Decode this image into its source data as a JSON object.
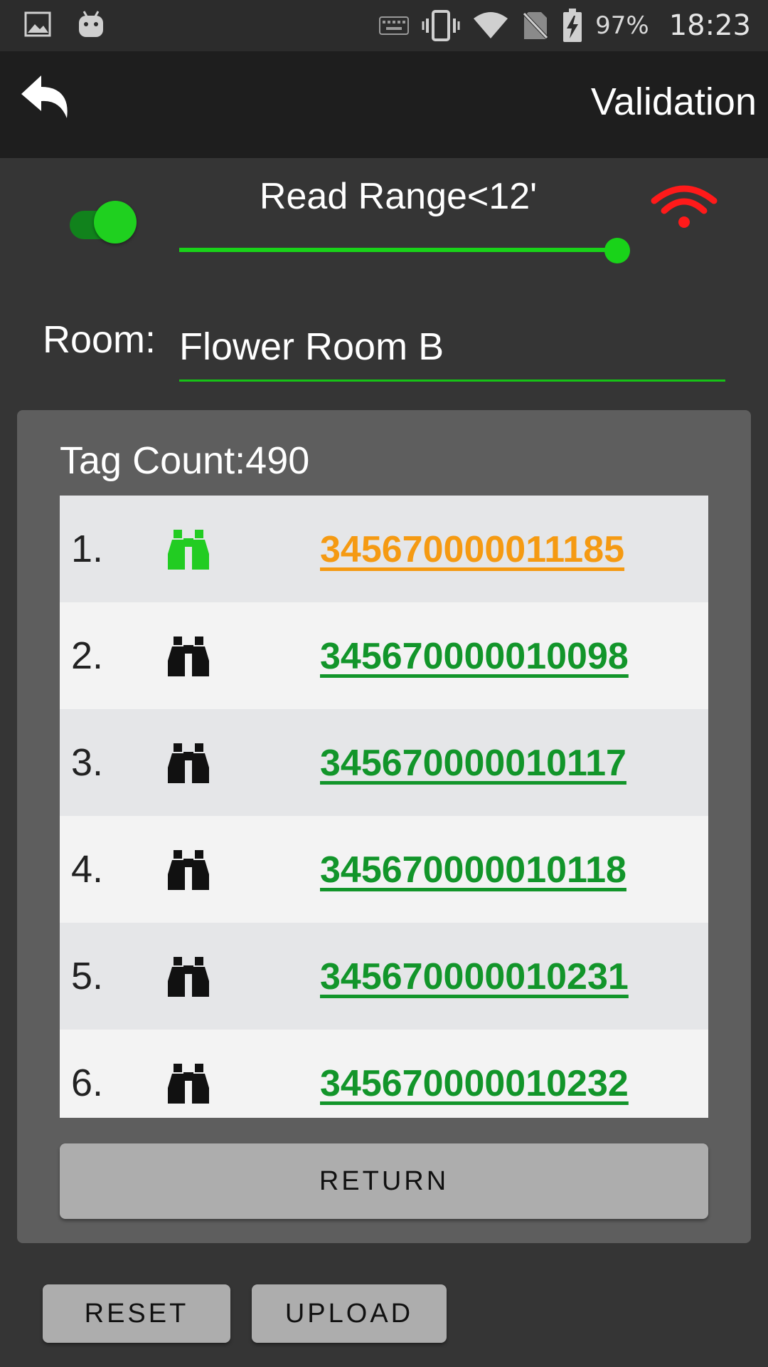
{
  "status_bar": {
    "icons": [
      "image-icon",
      "android-icon",
      "keyboard-icon",
      "vibrate-icon",
      "wifi-signal-icon",
      "no-sim-icon",
      "battery-charging-icon"
    ],
    "battery_percent": "97%",
    "time": "18:23"
  },
  "app_bar": {
    "back_icon": "back-arrow-icon",
    "title": "Validation"
  },
  "controls": {
    "toggle_on": true,
    "range_label": "Read Range<12'",
    "slider_value_fraction": 0.97,
    "signal_icon": "wifi-icon",
    "signal_color": "#ff1a1a"
  },
  "room": {
    "label": "Room:",
    "value": "Flower Room B"
  },
  "panel": {
    "tag_count_label": "Tag Count:",
    "tag_count_value": "490",
    "rows": [
      {
        "num": "1.",
        "tag": "345670000011185",
        "active": true
      },
      {
        "num": "2.",
        "tag": "345670000010098",
        "active": false
      },
      {
        "num": "3.",
        "tag": "345670000010117",
        "active": false
      },
      {
        "num": "4.",
        "tag": "345670000010118",
        "active": false
      },
      {
        "num": "5.",
        "tag": "345670000010231",
        "active": false
      },
      {
        "num": "6.",
        "tag": "345670000010232",
        "active": false
      }
    ],
    "return_label": "RETURN"
  },
  "bottom": {
    "reset_label": "RESET",
    "upload_label": "UPLOAD"
  },
  "colors": {
    "accent_green": "#19d319",
    "link_green": "#12952a",
    "active_orange": "#f59a12",
    "active_binoculars": "#22cc22"
  }
}
